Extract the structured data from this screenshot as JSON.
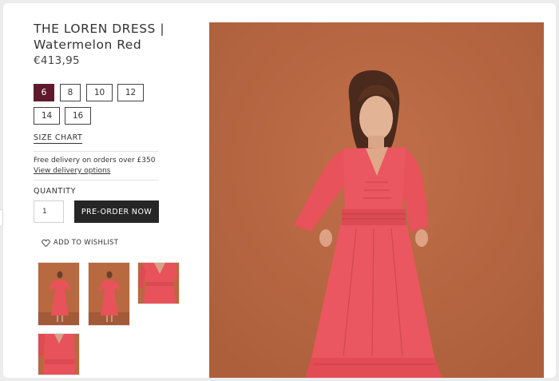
{
  "product": {
    "title": "THE LOREN DRESS | Watermelon Red",
    "price": "€413,95"
  },
  "sizes": {
    "options": [
      "6",
      "8",
      "10",
      "12",
      "14",
      "16"
    ],
    "selected": "6"
  },
  "size_chart_label": "SIZE CHART",
  "delivery": {
    "text": "Free delivery on orders over £350",
    "link_label": "View delivery options"
  },
  "quantity": {
    "label": "QUANTITY",
    "value": "1"
  },
  "preorder_label": "PRE-ORDER NOW",
  "wishlist_label": "ADD TO WISHLIST",
  "colors": {
    "selected_size": "#5e1a2c",
    "preorder_button": "#262626",
    "backdrop": "#b96a45",
    "dress": "#e8525a"
  },
  "icons": {
    "wishlist": "heart-outline-icon"
  },
  "gallery": {
    "thumbnail_count": 4
  }
}
